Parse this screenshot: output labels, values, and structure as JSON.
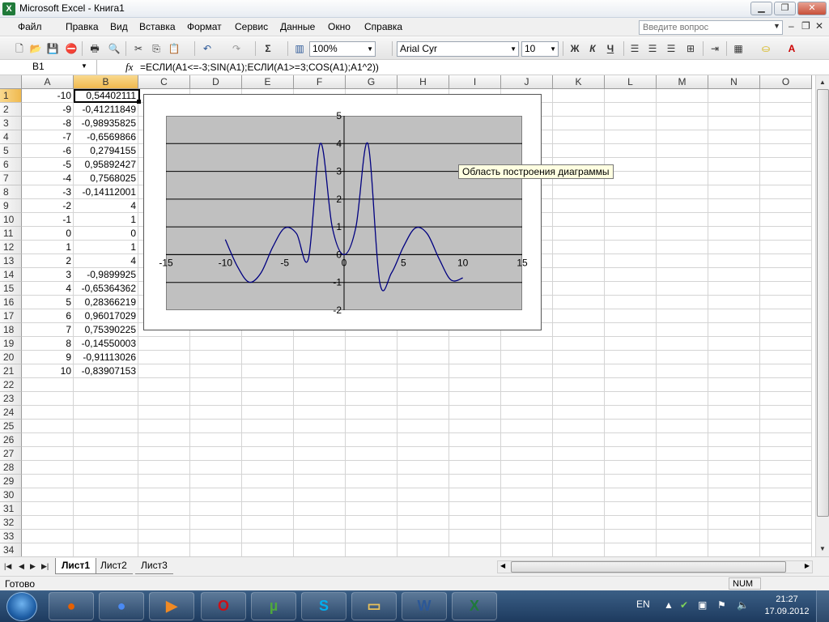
{
  "window": {
    "title": "Microsoft Excel - Книга1",
    "app_icon": "X"
  },
  "menu": [
    "Файл",
    "Правка",
    "Вид",
    "Вставка",
    "Формат",
    "Сервис",
    "Данные",
    "Окно",
    "Справка"
  ],
  "help_box": {
    "placeholder": "Введите вопрос"
  },
  "toolbar": {
    "zoom": "100%",
    "font": "Arial Cyr",
    "font_size": "10",
    "bold": "Ж",
    "italic": "К",
    "underline": "Ч",
    "sum": "Σ"
  },
  "formula_bar": {
    "name_box": "B1",
    "fx": "fx",
    "formula": "=ЕСЛИ(A1<=-3;SIN(A1);ЕСЛИ(A1>=3;COS(A1);A1^2))"
  },
  "columns": [
    "A",
    "B",
    "C",
    "D",
    "E",
    "F",
    "G",
    "H",
    "I",
    "J",
    "K",
    "L",
    "M",
    "N",
    "O"
  ],
  "rows": [
    "1",
    "2",
    "3",
    "4",
    "5",
    "6",
    "7",
    "8",
    "9",
    "10",
    "11",
    "12",
    "13",
    "14",
    "15",
    "16",
    "17",
    "18",
    "19",
    "20",
    "21",
    "22",
    "23",
    "24",
    "25",
    "26",
    "27",
    "28",
    "29",
    "30",
    "31",
    "32",
    "33",
    "34"
  ],
  "col_a": [
    "-10",
    "-9",
    "-8",
    "-7",
    "-6",
    "-5",
    "-4",
    "-3",
    "-2",
    "-1",
    "0",
    "1",
    "2",
    "3",
    "4",
    "5",
    "6",
    "7",
    "8",
    "9",
    "10"
  ],
  "col_b": [
    "0,54402111",
    "-0,41211849",
    "-0,98935825",
    "-0,6569866",
    "0,2794155",
    "0,95892427",
    "0,7568025",
    "-0,14112001",
    "4",
    "1",
    "0",
    "1",
    "4",
    "-0,9899925",
    "-0,65364362",
    "0,28366219",
    "0,96017029",
    "0,75390225",
    "-0,14550003",
    "-0,91113026",
    "-0,83907153"
  ],
  "chart_data": {
    "type": "scatter",
    "series": [
      {
        "x": [
          -10,
          -9,
          -8,
          -7,
          -6,
          -5,
          -4,
          -3,
          -2,
          -1,
          0,
          1,
          2,
          3,
          4,
          5,
          6,
          7,
          8,
          9,
          10
        ],
        "y": [
          0.54402111,
          -0.41211849,
          -0.98935825,
          -0.6569866,
          0.2794155,
          0.95892427,
          0.7568025,
          -0.14112001,
          4,
          1,
          0,
          1,
          4,
          -0.9899925,
          -0.65364362,
          0.28366219,
          0.96017029,
          0.75390225,
          -0.14550003,
          -0.91113026,
          -0.83907153
        ]
      }
    ],
    "xlim": [
      -15,
      15
    ],
    "ylim": [
      -2,
      5
    ],
    "x_ticks": [
      -15,
      -10,
      -5,
      0,
      5,
      10,
      15
    ],
    "y_ticks": [
      -2,
      -1,
      0,
      1,
      2,
      3,
      4,
      5
    ],
    "grid": "horizontal",
    "colors": {
      "plot_bg": "#C0C0C0",
      "line": "#000080"
    }
  },
  "tooltip": "Область построения диаграммы",
  "sheets": [
    "Лист1",
    "Лист2",
    "Лист3"
  ],
  "status": {
    "text": "Готово",
    "num": "NUM"
  },
  "taskbar": {
    "apps": [
      {
        "name": "firefox",
        "glyph": "●",
        "color": "#e66000"
      },
      {
        "name": "chrome",
        "glyph": "●",
        "color": "#4a8af4"
      },
      {
        "name": "media-player",
        "glyph": "▶",
        "color": "#f08a24"
      },
      {
        "name": "opera",
        "glyph": "O",
        "color": "#cc0f16"
      },
      {
        "name": "utorrent",
        "glyph": "µ",
        "color": "#4fa83d"
      },
      {
        "name": "skype",
        "glyph": "S",
        "color": "#00aff0"
      },
      {
        "name": "explorer",
        "glyph": "▭",
        "color": "#e8c15a"
      },
      {
        "name": "word",
        "glyph": "W",
        "color": "#2b5797"
      },
      {
        "name": "excel",
        "glyph": "X",
        "color": "#1f7a3a"
      }
    ],
    "lang": "EN",
    "time": "21:27",
    "date": "17.09.2012"
  }
}
